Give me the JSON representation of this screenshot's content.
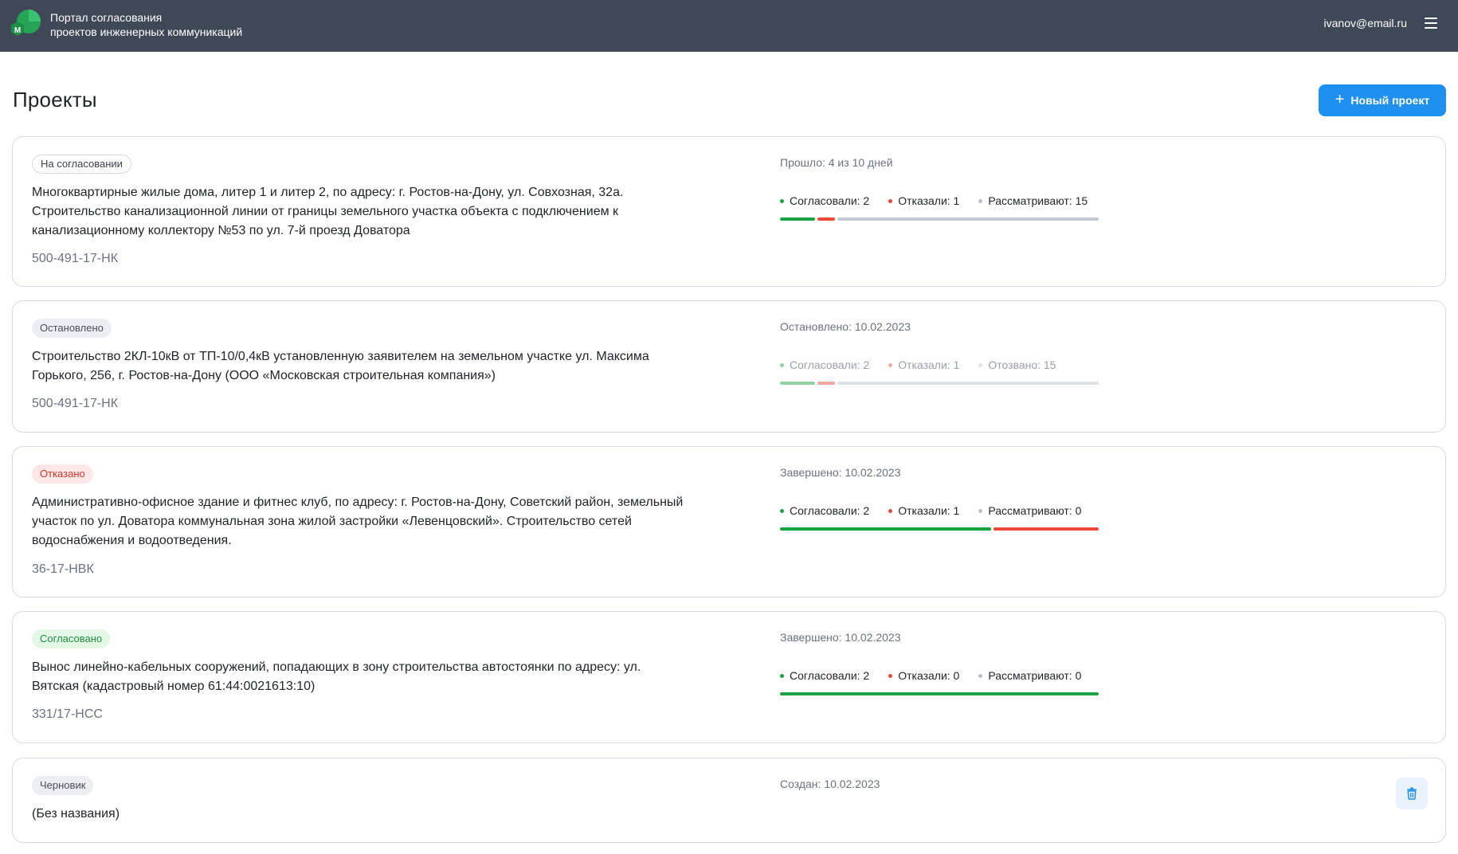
{
  "header": {
    "portal_title_line1": "Портал согласования",
    "portal_title_line2": "проектов инженерных коммуникаций",
    "logo_letter": "M",
    "user_email": "ivanov@email.ru"
  },
  "page": {
    "title": "Проекты",
    "new_project_label": "Новый проект"
  },
  "colors": {
    "header_bg": "#3f4856",
    "primary": "#1f8ff0",
    "green": "#1aa340",
    "red": "#f0473b",
    "grey": "#c3cad5"
  },
  "projects": [
    {
      "status": "На согласовании",
      "description": "Многоквартирные жилые дома, литер 1 и литер 2, по адресу: г. Ростов-на-Дону, ул. Совхозная, 32а. Строительство канализационной линии от границы земельного участка объекта с подключением к канализационному коллектору №53 по ул. 7-й проезд Доватора",
      "code": "500-491-17-НК",
      "info": "Прошло: 4 из 10 дней",
      "stat_approved": "Согласовали: 2",
      "stat_rejected": "Отказали: 1",
      "stat_pending": "Рассматривают: 15",
      "counts": {
        "approved": 2,
        "rejected": 1,
        "pending": 15
      }
    },
    {
      "status": "Остановлено",
      "description": "Строительство 2КЛ-10кВ от ТП-10/0,4кВ установленную заявителем на земельном участке ул. Максима Горького, 256, г. Ростов-на-Дону (ООО «Московская строительная компания»)",
      "code": "500-491-17-НК",
      "info": "Остановлено: 10.02.2023",
      "stat_approved": "Согласовали: 2",
      "stat_rejected": "Отказали: 1",
      "stat_pending": "Отозвано: 15",
      "counts": {
        "approved": 2,
        "rejected": 1,
        "pending": 15
      }
    },
    {
      "status": "Отказано",
      "description": "Административно-офисное здание и фитнес клуб, по адресу: г. Ростов-на-Дону, Советский район, земельный участок по ул. Доватора коммунальная зона жилой застройки «Левенцовский». Строительство сетей водоснабжения и водоотведения.",
      "code": "36-17-НВК",
      "info": "Завершено: 10.02.2023",
      "stat_approved": "Согласовали: 2",
      "stat_rejected": "Отказали: 1",
      "stat_pending": "Рассматривают: 0",
      "counts": {
        "approved": 2,
        "rejected": 1,
        "pending": 0
      }
    },
    {
      "status": "Согласовано",
      "description": "Вынос линейно-кабельных сооружений, попадающих в зону строительства автостоянки по адресу: ул. Вятская (кадастровый номер 61:44:0021613:10)",
      "code": "331/17-НСС",
      "info": "Завершено: 10.02.2023",
      "stat_approved": "Согласовали: 2",
      "stat_rejected": "Отказали: 0",
      "stat_pending": "Рассматривают: 0",
      "counts": {
        "approved": 2,
        "rejected": 0,
        "pending": 0
      }
    },
    {
      "status": "Черновик",
      "description": "(Без названия)",
      "info": "Создан: 10.02.2023"
    }
  ]
}
